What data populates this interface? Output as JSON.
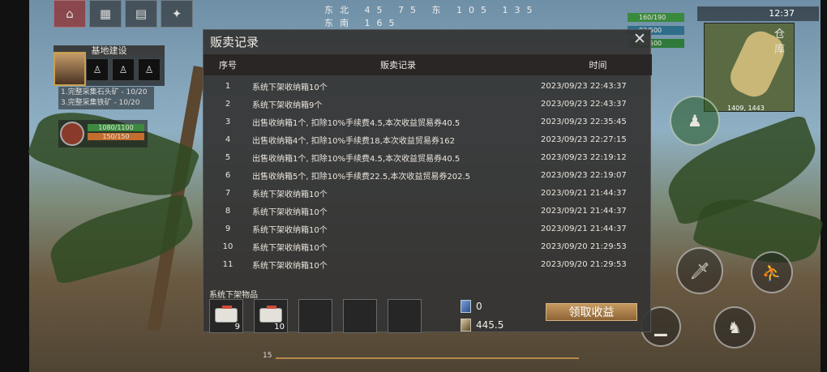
{
  "hud": {
    "compass": "东北   45   75   东   105   135   东南   165",
    "base_title": "基地建设",
    "tasks": [
      "1.完整采集石头矿 - 10/20",
      "3.完整采集铁矿 - 10/20"
    ],
    "hp": "1080/1100",
    "food": "150/150",
    "status": [
      "160/190",
      "82/500",
      "69/500"
    ],
    "clock": "12:37",
    "map_label": "仓库",
    "coords": "1409, 1443"
  },
  "modal": {
    "title": "贩卖记录",
    "columns": {
      "no": "序号",
      "record": "贩卖记录",
      "time": "时间"
    },
    "rows": [
      {
        "no": "1",
        "record": "系统下架收纳箱10个",
        "time": "2023/09/23 22:43:37"
      },
      {
        "no": "2",
        "record": "系统下架收纳箱9个",
        "time": "2023/09/23 22:43:37"
      },
      {
        "no": "3",
        "record": "出售收纳箱1个, 扣除10%手续费4.5,本次收益贸易券40.5",
        "time": "2023/09/23 22:35:45"
      },
      {
        "no": "4",
        "record": "出售收纳箱4个, 扣除10%手续费18,本次收益贸易券162",
        "time": "2023/09/23 22:27:15"
      },
      {
        "no": "5",
        "record": "出售收纳箱1个, 扣除10%手续费4.5,本次收益贸易券40.5",
        "time": "2023/09/23 22:19:12"
      },
      {
        "no": "6",
        "record": "出售收纳箱5个, 扣除10%手续费22.5,本次收益贸易券202.5",
        "time": "2023/09/23 22:19:07"
      },
      {
        "no": "7",
        "record": "系统下架收纳箱10个",
        "time": "2023/09/21 21:44:37"
      },
      {
        "no": "8",
        "record": "系统下架收纳箱10个",
        "time": "2023/09/21 21:44:37"
      },
      {
        "no": "9",
        "record": "系统下架收纳箱10个",
        "time": "2023/09/21 21:44:37"
      },
      {
        "no": "10",
        "record": "系统下架收纳箱10个",
        "time": "2023/09/20 21:29:53"
      },
      {
        "no": "11",
        "record": "系统下架收纳箱10个",
        "time": "2023/09/20 21:29:53"
      }
    ],
    "slots_label": "系统下架物品",
    "slots": [
      {
        "item": "storage-box",
        "count": "9"
      },
      {
        "item": "storage-box",
        "count": "10"
      },
      {
        "item": "",
        "count": ""
      },
      {
        "item": "",
        "count": ""
      },
      {
        "item": "",
        "count": ""
      }
    ],
    "currency_1": "0",
    "currency_2": "445.5",
    "claim_label": "领取收益"
  },
  "bottom_number": "15"
}
